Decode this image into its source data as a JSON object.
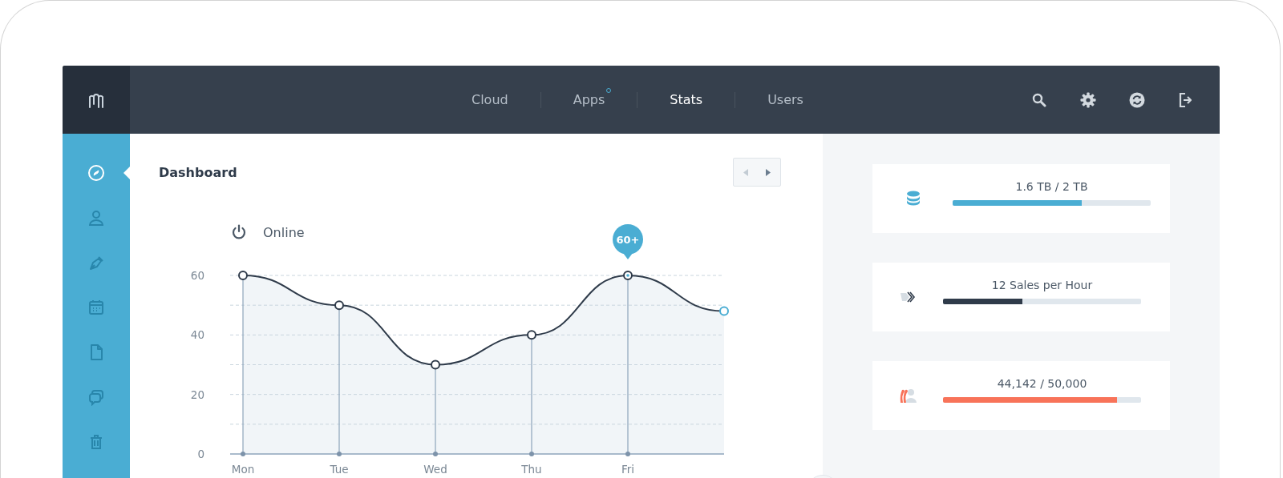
{
  "nav": [
    {
      "label": "Cloud",
      "selected": false,
      "badge": false
    },
    {
      "label": "Apps",
      "selected": false,
      "badge": true
    },
    {
      "label": "Stats",
      "selected": true,
      "badge": false
    },
    {
      "label": "Users",
      "selected": false,
      "badge": false
    }
  ],
  "toolbar": [
    {
      "kind": "search"
    },
    {
      "kind": "settings"
    },
    {
      "kind": "sync"
    },
    {
      "kind": "logout"
    }
  ],
  "sidebar": {
    "items": [
      {
        "kind": "compass",
        "selected": true
      },
      {
        "kind": "user",
        "selected": false
      },
      {
        "kind": "pen",
        "selected": false
      },
      {
        "kind": "calendar",
        "selected": false
      },
      {
        "kind": "file",
        "selected": false
      },
      {
        "kind": "chat",
        "selected": false
      },
      {
        "kind": "trash",
        "selected": false
      }
    ]
  },
  "dashboard": {
    "title": "Dashboard",
    "pager": [
      {
        "kind": "prev",
        "disabled": true
      },
      {
        "kind": "next",
        "disabled": false
      }
    ],
    "chart_data": {
      "type": "area",
      "grid": true,
      "categories": [
        "Mon",
        "Tue",
        "Wed",
        "Thu",
        "Fri",
        null
      ],
      "ylim": [
        0,
        60
      ],
      "yticks": [
        0,
        20,
        40,
        60
      ],
      "series": [
        {
          "name": "Online",
          "color": "#2f3b4a",
          "marker": "circle",
          "values": [
            60,
            50,
            30,
            40,
            60,
            48
          ]
        }
      ],
      "annotations": [
        {
          "x": "Fri",
          "y": 60,
          "text": "60+"
        }
      ]
    }
  },
  "stats": [
    {
      "kind": "storage",
      "label": "1.6 TB / 2 TB",
      "level": 0.65,
      "color": "#4aadd3"
    },
    {
      "kind": "sales",
      "label": "12 Sales per Hour",
      "level": 0.4,
      "color": "#2f3b4a"
    },
    {
      "kind": "users",
      "label": "44,142 / 50,000",
      "level": 0.88,
      "color": "#f87359"
    }
  ]
}
